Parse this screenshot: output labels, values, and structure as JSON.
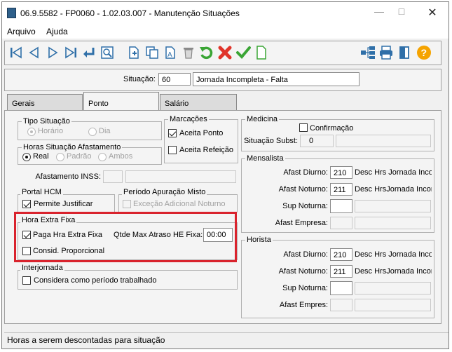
{
  "window": {
    "title": "06.9.5582 - FP0060 - 1.02.03.007 - Manutenção Situações"
  },
  "menu": {
    "arquivo": "Arquivo",
    "ajuda": "Ajuda"
  },
  "toolbar": {
    "icons": [
      "first-record",
      "prev-record",
      "next-record",
      "last-record",
      "return",
      "search",
      "new",
      "copy",
      "edit",
      "delete",
      "undo",
      "cancel",
      "confirm",
      "clear",
      "tree",
      "print",
      "exit",
      "help"
    ]
  },
  "header": {
    "situacao_label": "Situação:",
    "situacao_code": "60",
    "situacao_desc": "Jornada Incompleta - Falta"
  },
  "tabs": [
    {
      "label": "Gerais"
    },
    {
      "label": "Ponto"
    },
    {
      "label": "Salário"
    }
  ],
  "tipo_situacao": {
    "title": "Tipo Situação",
    "horario": "Horário",
    "dia": "Dia"
  },
  "horas_afast": {
    "title": "Horas Situação Afastamento",
    "real": "Real",
    "padrao": "Padrão",
    "ambos": "Ambos"
  },
  "marcacoes": {
    "title": "Marcações",
    "aceita_ponto": "Aceita Ponto",
    "aceita_refeicao": "Aceita Refeição"
  },
  "afastamento_inss": {
    "label": "Afastamento INSS:"
  },
  "portal_hcm": {
    "title": "Portal HCM",
    "permite_justificar": "Permite Justificar"
  },
  "periodo": {
    "title": "Período Apuração Misto",
    "excecao": "Exceção Adicional Noturno"
  },
  "hora_extra": {
    "title": "Hora Extra Fixa",
    "paga": "Paga Hra Extra Fixa",
    "qtde_label": "Qtde Max Atraso HE Fixa:",
    "qtde_value": "00:00",
    "consid": "Consid. Proporcional"
  },
  "interjornada": {
    "title": "Interjornada",
    "considera": "Considera como período trabalhado"
  },
  "medicina": {
    "title": "Medicina",
    "confirmacao": "Confirmação",
    "situacao_subst_label": "Situação Subst:",
    "situacao_subst_value": "0"
  },
  "mensalista": {
    "title": "Mensalista",
    "afast_diurno_label": "Afast Diurno:",
    "afast_diurno_code": "210",
    "afast_diurno_desc": "Desc Hrs Jornada Inco",
    "afast_noturno_label": "Afast Noturno:",
    "afast_noturno_code": "211",
    "afast_noturno_desc": "Desc HrsJornada Incon",
    "sup_noturna_label": "Sup Noturna:",
    "afast_empresa_label": "Afast Empresa:"
  },
  "horista": {
    "title": "Horista",
    "afast_diurno_label": "Afast Diurno:",
    "afast_diurno_code": "210",
    "afast_diurno_desc": "Desc Hrs Jornada Inco",
    "afast_noturno_label": "Afast Noturno:",
    "afast_noturno_code": "211",
    "afast_noturno_desc": "Desc HrsJornada Incon",
    "sup_noturna_label": "Sup Noturna:",
    "afast_empres_label": "Afast Empres:"
  },
  "status": {
    "text": "Horas a serem descontadas para situação"
  },
  "colors": {
    "highlight": "#d9232d",
    "toolbar_blue": "#2f6fa8",
    "undo_green": "#3aa535",
    "cancel_red": "#e0342a",
    "help_orange": "#f5a300"
  }
}
